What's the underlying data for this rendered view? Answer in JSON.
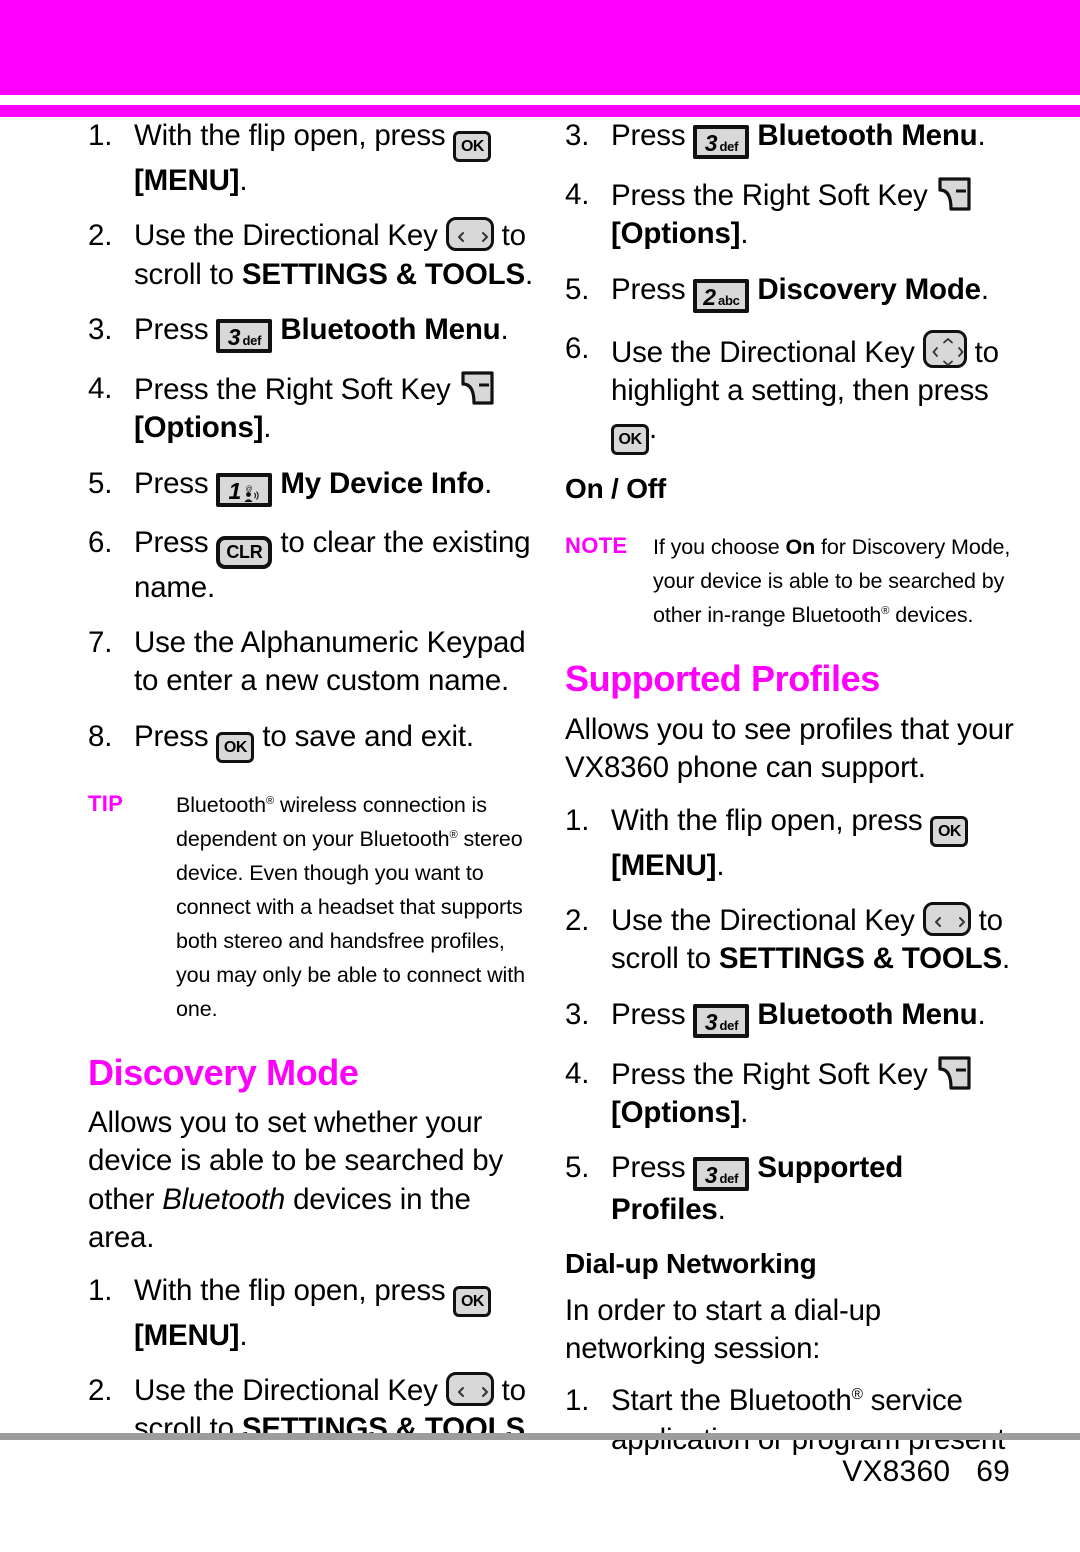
{
  "colors": {
    "accent": "#ff00ff",
    "key_fill": "#d8d8d8",
    "key_border": "#111111",
    "footer_rule": "#9d9d9d"
  },
  "icons": {
    "ok_key": "ok-key-icon",
    "clr_key": "clr-key-icon",
    "directional_key_lr": "directional-key-left-right-icon",
    "directional_key_4way": "directional-key-4way-icon",
    "right_soft_key": "right-soft-key-icon",
    "voicemail": "voicemail-icon"
  },
  "key_labels": {
    "ok": "OK",
    "clr": "CLR",
    "one_digit": "1",
    "two_digit": "2",
    "two_sub": "abc",
    "three_digit": "3",
    "three_sub": "def"
  },
  "left_column": {
    "my_device_info_steps": [
      {
        "num": "1.",
        "parts": [
          {
            "t": "text",
            "v": "With the flip open, press "
          },
          {
            "t": "icon",
            "v": "ok"
          },
          {
            "t": "text",
            "v": " "
          },
          {
            "t": "bold",
            "v": "[MENU]"
          },
          {
            "t": "text",
            "v": "."
          }
        ]
      },
      {
        "num": "2.",
        "parts": [
          {
            "t": "text",
            "v": "Use the Directional Key "
          },
          {
            "t": "icon",
            "v": "dir-lr"
          },
          {
            "t": "text",
            "v": " to scroll to "
          },
          {
            "t": "bold",
            "v": "SETTINGS & TOOLS"
          },
          {
            "t": "text",
            "v": "."
          }
        ]
      },
      {
        "num": "3.",
        "parts": [
          {
            "t": "text",
            "v": "Press "
          },
          {
            "t": "icon",
            "v": "key3"
          },
          {
            "t": "text",
            "v": " "
          },
          {
            "t": "bold",
            "v": "Bluetooth Menu"
          },
          {
            "t": "text",
            "v": "."
          }
        ]
      },
      {
        "num": "4.",
        "parts": [
          {
            "t": "text",
            "v": "Press the Right Soft Key "
          },
          {
            "t": "icon",
            "v": "soft"
          },
          {
            "t": "text",
            "v": " "
          },
          {
            "t": "bold",
            "v": "[Options]"
          },
          {
            "t": "text",
            "v": "."
          }
        ]
      },
      {
        "num": "5.",
        "parts": [
          {
            "t": "text",
            "v": "Press "
          },
          {
            "t": "icon",
            "v": "key1"
          },
          {
            "t": "text",
            "v": " "
          },
          {
            "t": "bold",
            "v": "My Device Info"
          },
          {
            "t": "text",
            "v": "."
          }
        ]
      },
      {
        "num": "6.",
        "parts": [
          {
            "t": "text",
            "v": "Press "
          },
          {
            "t": "icon",
            "v": "clr"
          },
          {
            "t": "text",
            "v": " to clear the existing name."
          }
        ]
      },
      {
        "num": "7.",
        "parts": [
          {
            "t": "text",
            "v": "Use the Alphanumeric Keypad to enter a new custom name."
          }
        ]
      },
      {
        "num": "8.",
        "parts": [
          {
            "t": "text",
            "v": "Press "
          },
          {
            "t": "icon",
            "v": "ok"
          },
          {
            "t": "text",
            "v": " to save and exit."
          }
        ]
      }
    ],
    "tip": {
      "label": "TIP",
      "body": "Bluetooth® wireless connection is dependent on your Bluetooth® stereo device. Even though you want to connect with a headset that supports both stereo and handsfree profiles, you may only be able to connect with one."
    },
    "discovery_mode": {
      "heading": "Discovery Mode",
      "intro_pre": "Allows you to set whether your device is able to be searched by other ",
      "intro_italic": "Bluetooth",
      "intro_post": " devices in the area.",
      "steps": [
        {
          "num": "1.",
          "parts": [
            {
              "t": "text",
              "v": "With the flip open, press "
            },
            {
              "t": "icon",
              "v": "ok"
            },
            {
              "t": "text",
              "v": " "
            },
            {
              "t": "bold",
              "v": "[MENU]"
            },
            {
              "t": "text",
              "v": "."
            }
          ]
        },
        {
          "num": "2.",
          "parts": [
            {
              "t": "text",
              "v": "Use the Directional Key "
            },
            {
              "t": "icon",
              "v": "dir-lr"
            },
            {
              "t": "text",
              "v": " to scroll to "
            },
            {
              "t": "bold",
              "v": "SETTINGS & TOOLS"
            },
            {
              "t": "text",
              "v": "."
            }
          ]
        }
      ]
    }
  },
  "right_column": {
    "discovery_mode_steps": [
      {
        "num": "3.",
        "parts": [
          {
            "t": "text",
            "v": "Press "
          },
          {
            "t": "icon",
            "v": "key3"
          },
          {
            "t": "text",
            "v": " "
          },
          {
            "t": "bold",
            "v": "Bluetooth Menu"
          },
          {
            "t": "text",
            "v": "."
          }
        ]
      },
      {
        "num": "4.",
        "parts": [
          {
            "t": "text",
            "v": "Press the Right Soft Key "
          },
          {
            "t": "icon",
            "v": "soft"
          },
          {
            "t": "text",
            "v": " "
          },
          {
            "t": "bold",
            "v": "[Options]"
          },
          {
            "t": "text",
            "v": "."
          }
        ]
      },
      {
        "num": "5.",
        "parts": [
          {
            "t": "text",
            "v": "Press "
          },
          {
            "t": "icon",
            "v": "key2"
          },
          {
            "t": "text",
            "v": " "
          },
          {
            "t": "bold",
            "v": "Discovery Mode"
          },
          {
            "t": "text",
            "v": "."
          }
        ]
      },
      {
        "num": "6.",
        "parts": [
          {
            "t": "text",
            "v": "Use the Directional Key "
          },
          {
            "t": "icon",
            "v": "dir-4"
          },
          {
            "t": "text",
            "v": " to highlight a setting, then press "
          },
          {
            "t": "icon",
            "v": "ok"
          },
          {
            "t": "text",
            "v": "."
          }
        ]
      }
    ],
    "on_off_heading": "On / Off",
    "note": {
      "label": "NOTE",
      "pre": "If you choose ",
      "bold": "On",
      "post": " for Discovery Mode, your device is able to be searched by other in-range Bluetooth® devices."
    },
    "supported_profiles": {
      "heading": "Supported Profiles",
      "intro": "Allows you to see profiles that your VX8360 phone can support.",
      "steps": [
        {
          "num": "1.",
          "parts": [
            {
              "t": "text",
              "v": "With the flip open, press "
            },
            {
              "t": "icon",
              "v": "ok"
            },
            {
              "t": "text",
              "v": " "
            },
            {
              "t": "bold",
              "v": "[MENU]"
            },
            {
              "t": "text",
              "v": "."
            }
          ]
        },
        {
          "num": "2.",
          "parts": [
            {
              "t": "text",
              "v": "Use the Directional Key "
            },
            {
              "t": "icon",
              "v": "dir-lr"
            },
            {
              "t": "text",
              "v": " to scroll to "
            },
            {
              "t": "bold",
              "v": "SETTINGS & TOOLS"
            },
            {
              "t": "text",
              "v": "."
            }
          ]
        },
        {
          "num": "3.",
          "parts": [
            {
              "t": "text",
              "v": "Press "
            },
            {
              "t": "icon",
              "v": "key3"
            },
            {
              "t": "text",
              "v": " "
            },
            {
              "t": "bold",
              "v": "Bluetooth Menu"
            },
            {
              "t": "text",
              "v": "."
            }
          ]
        },
        {
          "num": "4.",
          "parts": [
            {
              "t": "text",
              "v": "Press the Right Soft Key "
            },
            {
              "t": "icon",
              "v": "soft"
            },
            {
              "t": "text",
              "v": " "
            },
            {
              "t": "bold",
              "v": "[Options]"
            },
            {
              "t": "text",
              "v": "."
            }
          ]
        },
        {
          "num": "5.",
          "parts": [
            {
              "t": "text",
              "v": "Press "
            },
            {
              "t": "icon",
              "v": "key3"
            },
            {
              "t": "text",
              "v": " "
            },
            {
              "t": "bold",
              "v": "Supported Profiles"
            },
            {
              "t": "text",
              "v": "."
            }
          ]
        }
      ]
    },
    "dialup": {
      "heading": "Dial-up Networking",
      "intro": "In order to start a dial-up networking session:",
      "steps": [
        {
          "num": "1.",
          "parts": [
            {
              "t": "text",
              "v": "Start the Bluetooth"
            },
            {
              "t": "sup",
              "v": "®"
            },
            {
              "t": "text",
              "v": " service application or program present"
            }
          ]
        }
      ]
    }
  },
  "footer": {
    "model": "VX8360",
    "page_number": "69"
  }
}
